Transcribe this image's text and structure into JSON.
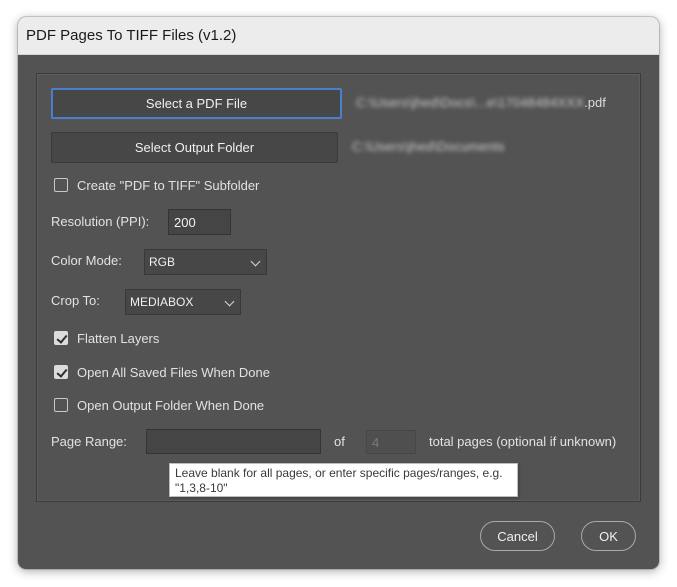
{
  "window": {
    "title": "PDF Pages To TIFF Files (v1.2)"
  },
  "source": {
    "button_label": "Select a PDF File",
    "path_obscured": "C:\\Users\\jhed\\Docs\\...e\\17048484XXX",
    "path_suffix": ".pdf"
  },
  "output": {
    "button_label": "Select Output Folder",
    "path_obscured": "C:\\Users\\jhed\\Documents"
  },
  "options": {
    "subfolder": {
      "label": "Create \"PDF to TIFF\" Subfolder",
      "checked": false
    },
    "flatten": {
      "label": "Flatten Layers",
      "checked": true
    },
    "open_saved": {
      "label": "Open All Saved Files When Done",
      "checked": true
    },
    "open_folder": {
      "label": "Open Output Folder When Done",
      "checked": false
    }
  },
  "resolution": {
    "label": "Resolution (PPI):",
    "value": "200"
  },
  "color_mode": {
    "label": "Color Mode:",
    "value": "RGB"
  },
  "crop": {
    "label": "Crop To:",
    "value": "MEDIABOX"
  },
  "page_range": {
    "label": "Page Range:",
    "value": "",
    "of_label": "of",
    "total_placeholder": "4",
    "total_label": "total pages (optional if unknown)",
    "tooltip": "Leave blank for all pages, or enter specific pages/ranges, e.g. \"1,3,8-10\""
  },
  "actions": {
    "cancel_label": "Cancel",
    "ok_label": "OK"
  },
  "colors": {
    "panel": "#535353",
    "focus": "#4a7fd0",
    "titlebar": "#ececec"
  }
}
